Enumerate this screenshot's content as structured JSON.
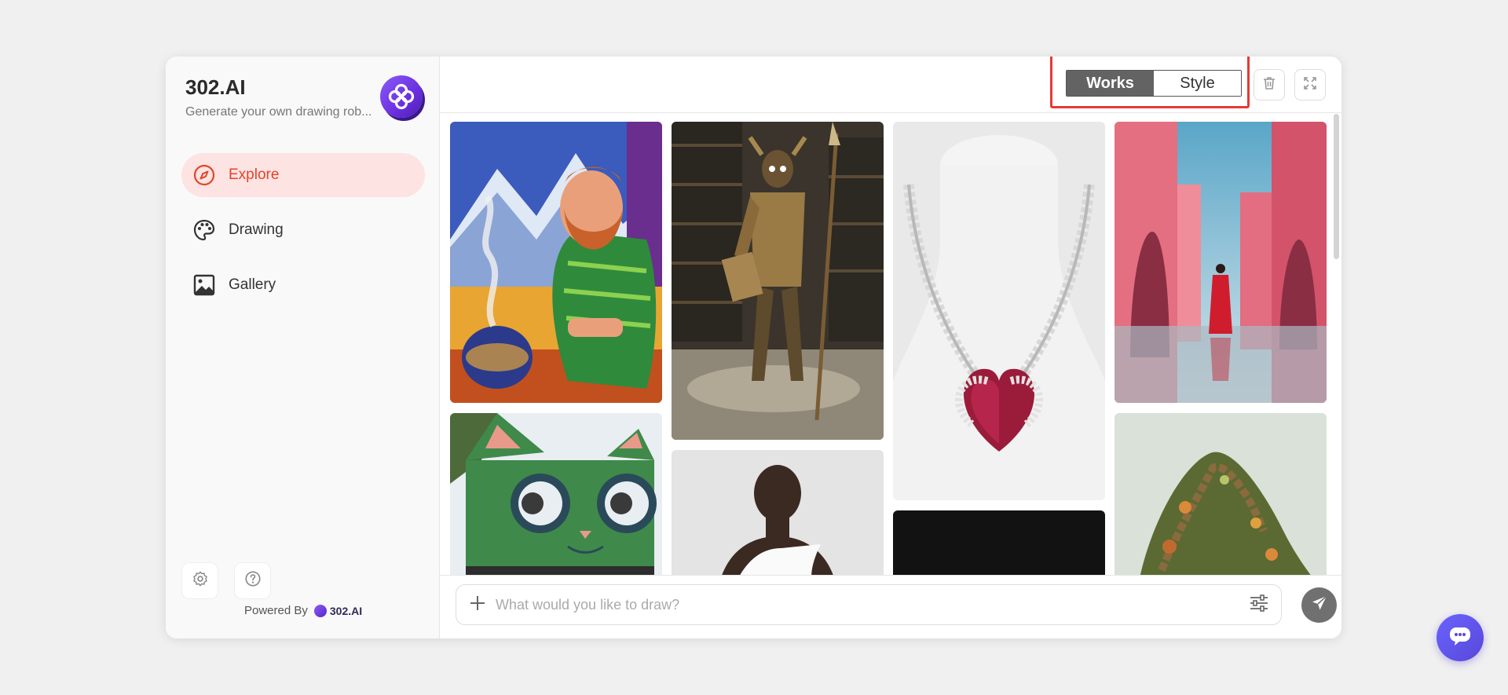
{
  "sidebar": {
    "title": "302.AI",
    "subtitle": "Generate your own drawing rob...",
    "nav": [
      {
        "label": "Explore",
        "icon": "compass-icon",
        "active": true
      },
      {
        "label": "Drawing",
        "icon": "palette-icon",
        "active": false
      },
      {
        "label": "Gallery",
        "icon": "image-icon",
        "active": false
      }
    ],
    "settings_icon": "gear-icon",
    "help_icon": "question-icon",
    "powered_by": "Powered By",
    "powered_brand": "302.AI"
  },
  "header": {
    "tabs": [
      {
        "label": "Works",
        "active": true
      },
      {
        "label": "Style",
        "active": false
      }
    ],
    "delete_icon": "trash-icon",
    "fullscreen_icon": "expand-icon"
  },
  "gallery": {
    "images": [
      {
        "name": "painted-bearded-man-coffee"
      },
      {
        "name": "armored-horned-warrior-spear"
      },
      {
        "name": "ruby-heart-diamond-necklace"
      },
      {
        "name": "red-robed-figure-pink-walls"
      },
      {
        "name": "green-cat-container-building"
      },
      {
        "name": "woman-white-top-portrait"
      },
      {
        "name": "dark-image"
      },
      {
        "name": "overgrown-hill-wooden-stairs"
      }
    ]
  },
  "composer": {
    "placeholder": "What would you like to draw?",
    "add_icon": "plus-icon",
    "settings_icon": "sliders-icon",
    "send_icon": "send-icon"
  },
  "colors": {
    "accent": "#e0452c",
    "active_nav_bg": "#fde3e1",
    "highlight_box": "#e53935",
    "brand_purple": "#6b2fe0"
  }
}
